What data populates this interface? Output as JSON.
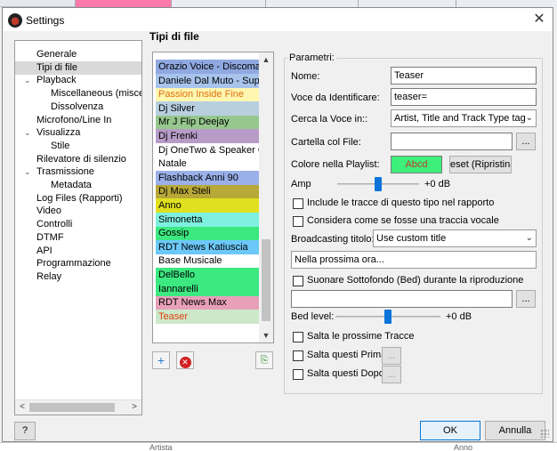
{
  "window": {
    "title": "Settings",
    "close_icon": "close-icon"
  },
  "tree": {
    "items": [
      {
        "label": "Generale",
        "level": 1,
        "expander": "",
        "selected": false
      },
      {
        "label": "Tipi di file",
        "level": 1,
        "expander": "",
        "selected": true
      },
      {
        "label": "Playback",
        "level": 1,
        "expander": "v",
        "selected": false
      },
      {
        "label": "Miscellaneous (miscela",
        "level": 2,
        "expander": "",
        "selected": false
      },
      {
        "label": "Dissolvenza",
        "level": 2,
        "expander": "",
        "selected": false
      },
      {
        "label": "Microfono/Line In",
        "level": 1,
        "expander": "",
        "selected": false
      },
      {
        "label": "Visualizza",
        "level": 1,
        "expander": "v",
        "selected": false
      },
      {
        "label": "Stile",
        "level": 2,
        "expander": "",
        "selected": false
      },
      {
        "label": "Rilevatore di silenzio",
        "level": 1,
        "expander": "",
        "selected": false
      },
      {
        "label": "Trasmissione",
        "level": 1,
        "expander": "v",
        "selected": false
      },
      {
        "label": "Metadata",
        "level": 2,
        "expander": "",
        "selected": false
      },
      {
        "label": "Log Files (Rapporti)",
        "level": 1,
        "expander": "",
        "selected": false
      },
      {
        "label": "Video",
        "level": 1,
        "expander": "",
        "selected": false
      },
      {
        "label": "Controlli",
        "level": 1,
        "expander": "",
        "selected": false
      },
      {
        "label": "DTMF",
        "level": 1,
        "expander": "",
        "selected": false
      },
      {
        "label": "API",
        "level": 1,
        "expander": "",
        "selected": false
      },
      {
        "label": "Programmazione",
        "level": 1,
        "expander": "",
        "selected": false
      },
      {
        "label": "Relay",
        "level": 1,
        "expander": "",
        "selected": false
      }
    ]
  },
  "section_title": "Tipi di file",
  "file_types": [
    {
      "label": "Orazio Voice - Discomania",
      "bg": "#8fa8e0",
      "fg": "#000000"
    },
    {
      "label": "Daniele Dal Muto - Super...",
      "bg": "#a8c4ec",
      "fg": "#000000"
    },
    {
      "label": "Passion Inside Fine",
      "bg": "#fff6b0",
      "fg": "#e07010"
    },
    {
      "label": "Dj Silver",
      "bg": "#b8cfe0",
      "fg": "#000000"
    },
    {
      "label": "Mr J Flip Deejay",
      "bg": "#96c88e",
      "fg": "#000000"
    },
    {
      "label": "Dj Frenki",
      "bg": "#b89cc8",
      "fg": "#000000"
    },
    {
      "label": "Dj OneTwo & Speaker Oc...",
      "bg": "#ffffff",
      "fg": "#000000"
    },
    {
      "label": "Natale",
      "bg": "#ffffff",
      "fg": "#000000"
    },
    {
      "label": "Flashback Anni 90",
      "bg": "#9ab0e8",
      "fg": "#000000"
    },
    {
      "label": "Dj Max Steli",
      "bg": "#b8a838",
      "fg": "#000000"
    },
    {
      "label": "Anno",
      "bg": "#e0e020",
      "fg": "#000000"
    },
    {
      "label": "Simonetta",
      "bg": "#7ef0e0",
      "fg": "#000000"
    },
    {
      "label": "Gossip",
      "bg": "#3ce880",
      "fg": "#000000"
    },
    {
      "label": "RDT News Katiuscia",
      "bg": "#6cc8f8",
      "fg": "#000000"
    },
    {
      "label": "Base Musicale",
      "bg": "#ffffff",
      "fg": "#000000"
    },
    {
      "label": "DelBello",
      "bg": "#3ce880",
      "fg": "#000000"
    },
    {
      "label": "Iannarelli",
      "bg": "#3ce880",
      "fg": "#000000"
    },
    {
      "label": "RDT News Max",
      "bg": "#e8a0b8",
      "fg": "#000000"
    },
    {
      "label": "Teaser",
      "bg": "#cce8c8",
      "fg": "#e04010"
    }
  ],
  "toolbar": {
    "add_icon": "plus-icon",
    "remove_icon": "delete-icon",
    "export_icon": "export-icon"
  },
  "params": {
    "group_label": "Parametri:",
    "name_label": "Nome:",
    "name_value": "Teaser",
    "id_label": "Voce da Identificare:",
    "id_value": "teaser=",
    "search_label": "Cerca la Voce in::",
    "search_value": "Artist, Title and Track Type tag",
    "folder_label": "Cartella col File:",
    "folder_value": "",
    "browse_label": "...",
    "color_label": "Colore nella Playlist:",
    "color_preview": "Abcd",
    "color_bg": "#3cf07a",
    "color_fg": "#c0392b",
    "reset_label": "eset (Ripristina",
    "amp_label": "Amp",
    "amp_value": "+0 dB",
    "amp_level": 0.5,
    "include_report_label": "Include le tracce di questo tipo nel rapporto",
    "vocal_label": "Considera come se fosse una traccia vocale",
    "broadcast_label": "Broadcasting titolo:",
    "broadcast_value": "Use custom title",
    "custom_title_value": "Nella prossima ora...",
    "bed_label": "Suonare Sottofondo (Bed) durante la riproduzione",
    "bed_file_value": "",
    "bed_browse_label": "...",
    "bed_level_label": "Bed level:",
    "bed_level_value": "+0 dB",
    "bed_level": 0.5,
    "skip_next_label": "Salta le prossime Tracce",
    "skip_before_label": "Salta questi Prima",
    "skip_before_btn": "...",
    "skip_after_label": "Salta questi Dopo",
    "skip_after_btn": "..."
  },
  "footer": {
    "help_label": "?",
    "ok_label": "OK",
    "cancel_label": "Annulla"
  },
  "background": {
    "bottom_col1": "Artista",
    "bottom_col2": "Anno"
  }
}
